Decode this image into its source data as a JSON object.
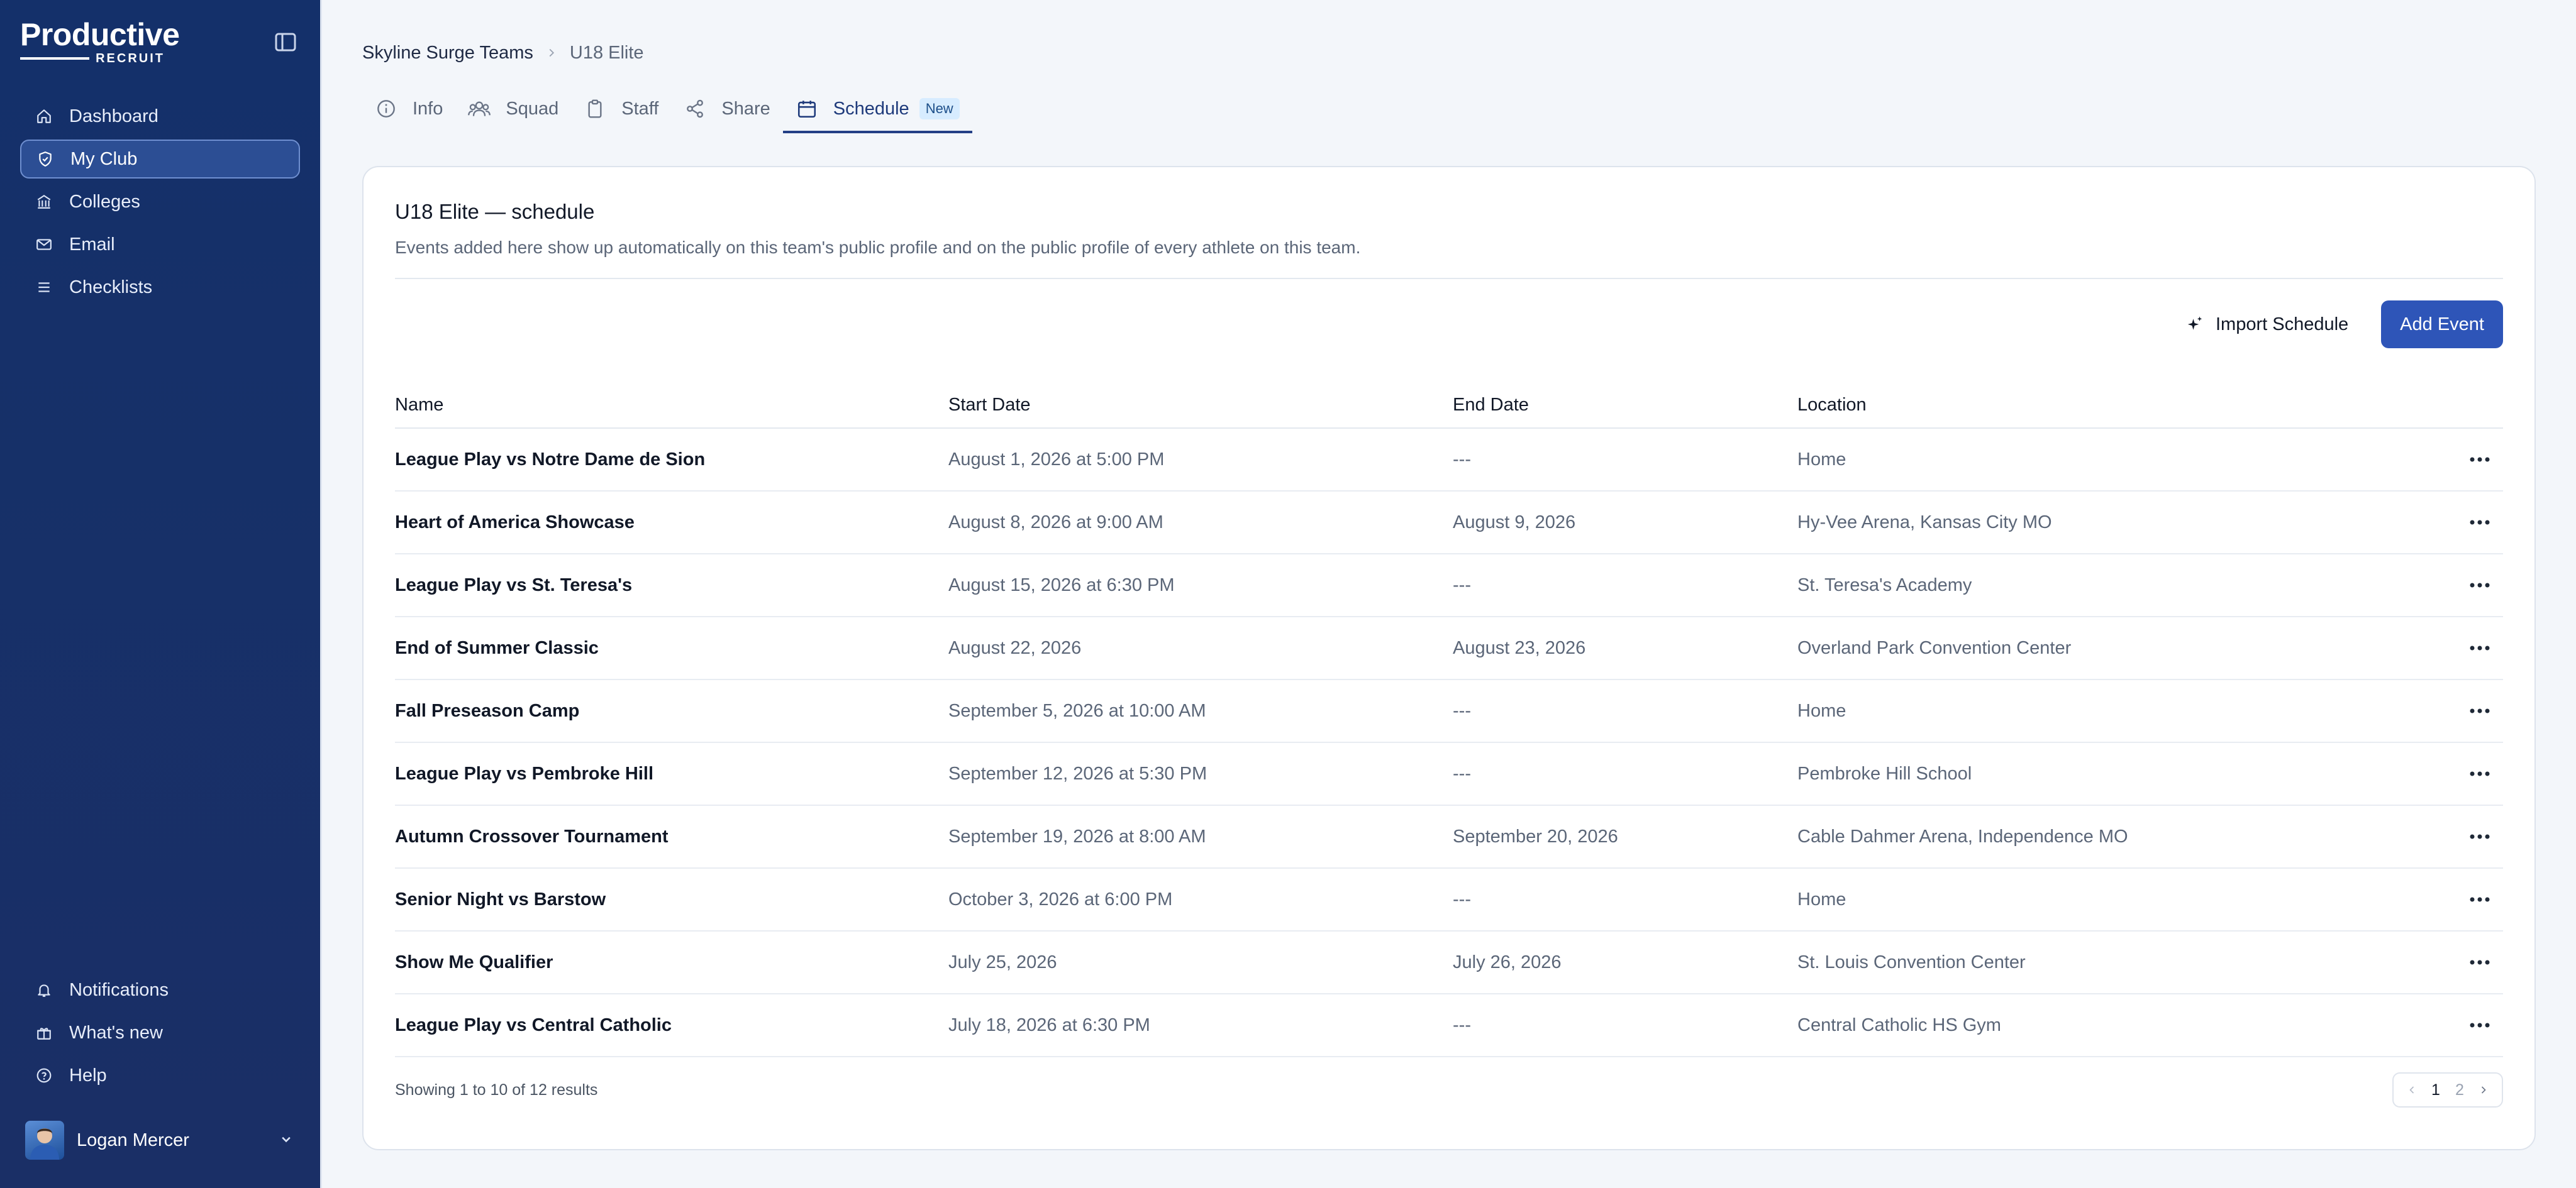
{
  "brand": {
    "name": "Productive",
    "sub": "RECRUIT"
  },
  "sidebar": {
    "items": [
      {
        "label": "Dashboard",
        "icon": "home-icon"
      },
      {
        "label": "My Club",
        "icon": "shield-icon",
        "active": true
      },
      {
        "label": "Colleges",
        "icon": "building-icon"
      },
      {
        "label": "Email",
        "icon": "mail-icon"
      },
      {
        "label": "Checklists",
        "icon": "list-icon"
      }
    ],
    "bottom_items": [
      {
        "label": "Notifications",
        "icon": "bell-icon"
      },
      {
        "label": "What's new",
        "icon": "gift-icon"
      },
      {
        "label": "Help",
        "icon": "help-icon"
      }
    ],
    "user": {
      "name": "Logan Mercer"
    }
  },
  "breadcrumb": {
    "parent": "Skyline Surge Teams",
    "current": "U18 Elite"
  },
  "tabs": [
    {
      "label": "Info",
      "icon": "info-icon"
    },
    {
      "label": "Squad",
      "icon": "users-icon"
    },
    {
      "label": "Staff",
      "icon": "clipboard-icon"
    },
    {
      "label": "Share",
      "icon": "share-icon"
    },
    {
      "label": "Schedule",
      "icon": "calendar-icon",
      "active": true,
      "badge": "New"
    }
  ],
  "card": {
    "title": "U18 Elite — schedule",
    "description": "Events added here show up automatically on this team's public profile and on the public profile of every athlete on this team.",
    "import_label": "Import Schedule",
    "add_label": "Add Event"
  },
  "table": {
    "headers": {
      "name": "Name",
      "start": "Start Date",
      "end": "End Date",
      "location": "Location"
    },
    "rows": [
      {
        "name": "League Play vs Notre Dame de Sion",
        "start": "August 1, 2026 at 5:00 PM",
        "end": "---",
        "location": "Home"
      },
      {
        "name": "Heart of America Showcase",
        "start": "August 8, 2026 at 9:00 AM",
        "end": "August 9, 2026",
        "location": "Hy-Vee Arena, Kansas City MO"
      },
      {
        "name": "League Play vs St. Teresa's",
        "start": "August 15, 2026 at 6:30 PM",
        "end": "---",
        "location": "St. Teresa's Academy"
      },
      {
        "name": "End of Summer Classic",
        "start": "August 22, 2026",
        "end": "August 23, 2026",
        "location": "Overland Park Convention Center"
      },
      {
        "name": "Fall Preseason Camp",
        "start": "September 5, 2026 at 10:00 AM",
        "end": "---",
        "location": "Home"
      },
      {
        "name": "League Play vs Pembroke Hill",
        "start": "September 12, 2026 at 5:30 PM",
        "end": "---",
        "location": "Pembroke Hill School"
      },
      {
        "name": "Autumn Crossover Tournament",
        "start": "September 19, 2026 at 8:00 AM",
        "end": "September 20, 2026",
        "location": "Cable Dahmer Arena, Independence MO"
      },
      {
        "name": "Senior Night vs Barstow",
        "start": "October 3, 2026 at 6:00 PM",
        "end": "---",
        "location": "Home"
      },
      {
        "name": "Show Me Qualifier",
        "start": "July 25, 2026",
        "end": "July 26, 2026",
        "location": "St. Louis Convention Center"
      },
      {
        "name": "League Play vs Central Catholic",
        "start": "July 18, 2026 at 6:30 PM",
        "end": "---",
        "location": "Central Catholic HS Gym"
      }
    ]
  },
  "pagination": {
    "summary": "Showing 1 to 10 of 12 results",
    "pages": [
      "1",
      "2"
    ],
    "current": "1"
  },
  "colors": {
    "sidebar": "#14306a",
    "accent": "#2e55b8",
    "active_tab": "#233f86"
  }
}
